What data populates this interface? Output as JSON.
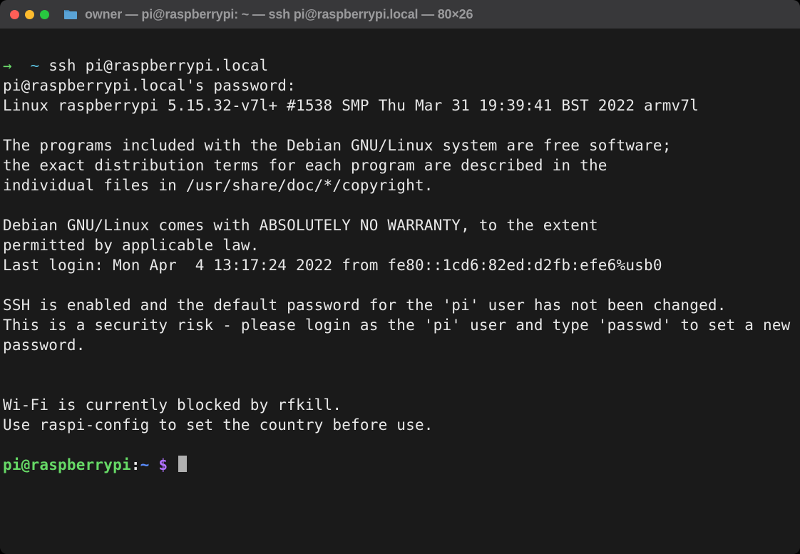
{
  "titlebar": {
    "title": "owner — pi@raspberrypi: ~ — ssh pi@raspberrypi.local — 80×26"
  },
  "terminal": {
    "local_prompt": {
      "arrow": "→",
      "path": "~",
      "command": "ssh pi@raspberrypi.local"
    },
    "lines": {
      "pw_prompt": "pi@raspberrypi.local's password:",
      "uname": "Linux raspberrypi 5.15.32-v7l+ #1538 SMP Thu Mar 31 19:39:41 BST 2022 armv7l",
      "motd1": "The programs included with the Debian GNU/Linux system are free software;",
      "motd2": "the exact distribution terms for each program are described in the",
      "motd3": "individual files in /usr/share/doc/*/copyright.",
      "motd4": "Debian GNU/Linux comes with ABSOLUTELY NO WARRANTY, to the extent",
      "motd5": "permitted by applicable law.",
      "lastlogin": "Last login: Mon Apr  4 13:17:24 2022 from fe80::1cd6:82ed:d2fb:efe6%usb0",
      "ssh1": "SSH is enabled and the default password for the 'pi' user has not been changed.",
      "ssh2": "This is a security risk - please login as the 'pi' user and type 'passwd' to set a new password.",
      "wifi1": "Wi-Fi is currently blocked by rfkill.",
      "wifi2": "Use raspi-config to set the country before use."
    },
    "remote_prompt": {
      "userhost": "pi@raspberrypi",
      "colon": ":",
      "path": "~ ",
      "dollar": "$"
    }
  }
}
